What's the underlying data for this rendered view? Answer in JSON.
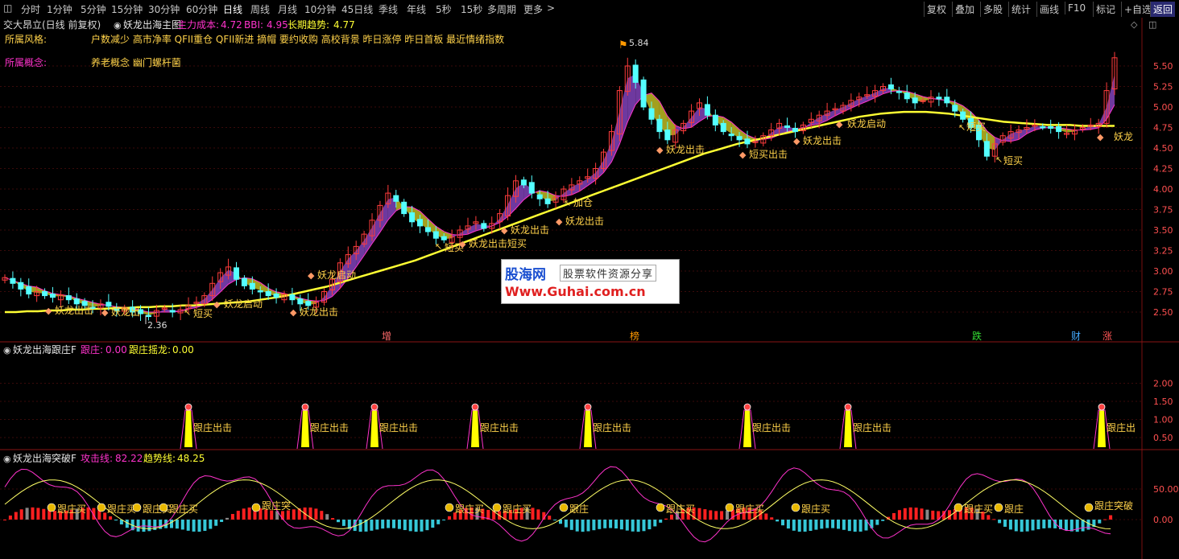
{
  "toolbar": {
    "periods": [
      "分时",
      "1分钟",
      "5分钟",
      "15分钟",
      "30分钟",
      "60分钟",
      "日线",
      "周线",
      "月线",
      "10分钟",
      "45日线",
      "季线",
      "年线",
      "5秒",
      "15秒",
      "多周期",
      "更多"
    ],
    "active_period": "日线",
    "right_buttons": [
      "复权",
      "叠加",
      "多股",
      "统计",
      "画线",
      "F10",
      "标记",
      "+自选",
      "返回"
    ]
  },
  "main_panel": {
    "stock_title": "交大昂立(日线 前复权)",
    "indicator_name": "妖龙出海主图",
    "main_cost_label": "主力成本:",
    "main_cost_value": "4.72",
    "bbi_label": "BBI:",
    "bbi_value": "4.95",
    "long_trend_label": "长期趋势:",
    "long_trend_value": "4.77",
    "style_label": "所属风格:",
    "style_value": "户数减少 高市净率 QFII重仓 QFII新进 摘帽 要约收购 高校背景 昨日涨停 昨日首板 最近情绪指数",
    "concept_label": "所属概念:",
    "concept_value": "养老概念 幽门螺杆菌",
    "y_ticks": [
      "5.50",
      "5.25",
      "5.00",
      "4.75",
      "4.50",
      "4.25",
      "4.00",
      "3.75",
      "3.50",
      "3.25",
      "3.00",
      "2.75",
      "2.50"
    ],
    "high_label": "5.84",
    "low_label": "2.36",
    "signals": [
      "妖龙出击",
      "妖龙出",
      "短买",
      "妖龙启动",
      "妖龙出击",
      "妖龙启动",
      "短买",
      "妖龙出击短买",
      "妖龙出击",
      "加仓",
      "妖龙出击",
      "妖龙出击",
      "短买出击",
      "妖龙出击",
      "妖龙启动",
      "短买",
      "短买",
      "妖龙"
    ],
    "events": [
      "增",
      "榜",
      "跌",
      "财",
      "涨"
    ]
  },
  "panel2": {
    "name": "妖龙出海跟庄F",
    "label1": "跟庄:",
    "value1": "0.00",
    "label2": "跟庄摇龙:",
    "value2": "0.00",
    "y_ticks": [
      "2.00",
      "1.50",
      "1.00",
      "0.50"
    ],
    "signal_text": "跟庄出击",
    "signal_short": "跟庄出"
  },
  "panel3": {
    "name": "妖龙出海突破F",
    "label1": "攻击线:",
    "value1": "82.22",
    "label2": "趋势线:",
    "value2": "48.25",
    "y_ticks": [
      "50.00",
      "0.00"
    ],
    "buy_text": "跟庄买",
    "buy_short": "跟庄",
    "breakout_text": "跟庄突破",
    "breakout_short": "跟庄突"
  },
  "banner": {
    "site_name": "股海网",
    "slogan": "股票软件资源分享",
    "url": "Www.Guhai.com.cn"
  },
  "colors": {
    "up": "#ff3c3c",
    "down": "#54ffff",
    "magenta": "#ff33cc",
    "yellow": "#ffff33",
    "purple": "#7a3fb0",
    "olive": "#b5b020",
    "label_gold": "#ffd24a"
  },
  "chart_data": {
    "type": "candlestick",
    "price_range": [
      2.3,
      5.9
    ],
    "closes": [
      2.92,
      2.85,
      2.78,
      2.72,
      2.75,
      2.7,
      2.68,
      2.71,
      2.65,
      2.6,
      2.58,
      2.55,
      2.6,
      2.57,
      2.52,
      2.55,
      2.5,
      2.48,
      2.45,
      2.52,
      2.55,
      2.5,
      2.53,
      2.58,
      2.62,
      2.7,
      2.85,
      2.98,
      3.05,
      2.9,
      2.82,
      2.78,
      2.75,
      2.7,
      2.68,
      2.72,
      2.65,
      2.6,
      2.58,
      2.62,
      2.75,
      2.9,
      3.1,
      3.2,
      3.3,
      3.45,
      3.62,
      3.8,
      3.95,
      3.85,
      3.7,
      3.6,
      3.55,
      3.48,
      3.4,
      3.38,
      3.42,
      3.5,
      3.55,
      3.6,
      3.52,
      3.58,
      3.7,
      3.92,
      4.1,
      4.05,
      3.95,
      3.88,
      3.82,
      3.9,
      4.0,
      4.05,
      4.1,
      4.15,
      4.25,
      4.45,
      4.7,
      5.2,
      5.5,
      5.3,
      5.0,
      4.85,
      4.7,
      4.6,
      4.72,
      4.8,
      4.95,
      5.05,
      4.9,
      4.78,
      4.7,
      4.65,
      4.6,
      4.55,
      4.58,
      4.65,
      4.72,
      4.8,
      4.75,
      4.7,
      4.78,
      4.85,
      4.9,
      4.95,
      4.98,
      5.02,
      5.08,
      5.12,
      5.15,
      5.2,
      5.25,
      5.22,
      5.18,
      5.1,
      5.05,
      5.08,
      5.12,
      5.1,
      5.05,
      4.95,
      4.85,
      4.75,
      4.6,
      4.4,
      4.55,
      4.65,
      4.7,
      4.72,
      4.75,
      4.78,
      4.76,
      4.74,
      4.7,
      4.68,
      4.72,
      4.75,
      4.78,
      4.8,
      5.2,
      5.6
    ],
    "yellow_line": [
      2.5,
      2.5,
      2.51,
      2.51,
      2.52,
      2.52,
      2.53,
      2.53,
      2.54,
      2.54,
      2.55,
      2.55,
      2.56,
      2.56,
      2.57,
      2.57,
      2.58,
      2.58,
      2.59,
      2.6,
      2.61,
      2.62,
      2.63,
      2.65,
      2.67,
      2.69,
      2.72,
      2.75,
      2.78,
      2.81,
      2.85,
      2.89,
      2.93,
      2.97,
      3.01,
      3.05,
      3.09,
      3.13,
      3.18,
      3.23,
      3.28,
      3.33,
      3.38,
      3.43,
      3.48,
      3.53,
      3.58,
      3.63,
      3.68,
      3.73,
      3.78,
      3.83,
      3.88,
      3.93,
      3.98,
      4.03,
      4.08,
      4.13,
      4.18,
      4.23,
      4.28,
      4.33,
      4.38,
      4.43,
      4.47,
      4.51,
      4.55,
      4.58,
      4.61,
      4.64,
      4.67,
      4.7,
      4.73,
      4.76,
      4.79,
      4.82,
      4.85,
      4.88,
      4.9,
      4.92,
      4.93,
      4.94,
      4.94,
      4.94,
      4.93,
      4.92,
      4.9,
      4.88,
      4.86,
      4.84,
      4.82,
      4.81,
      4.8,
      4.79,
      4.78,
      4.78,
      4.78,
      4.77,
      4.77,
      4.77,
      4.77
    ]
  }
}
